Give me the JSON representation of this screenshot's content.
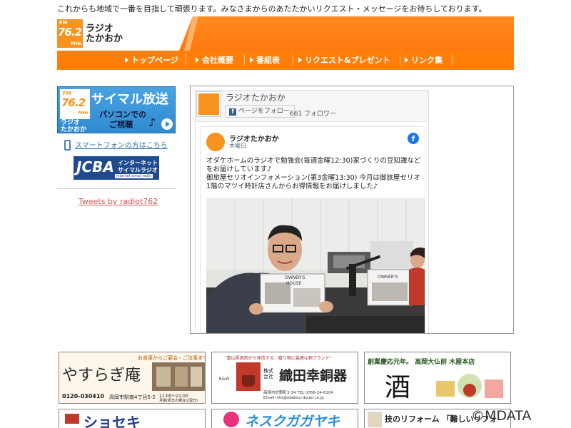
{
  "tagline": "これからも地域で一番を目指して頑張ります。みなさまからのあたたかいリクエスト・メッセージをお待ちしております。",
  "logo": {
    "fm": "FM",
    "freq": "76.2",
    "mhz": "MHz",
    "name_line1": "ラジオ",
    "name_line2": "たかおか"
  },
  "nav": [
    {
      "label": "トップページ"
    },
    {
      "label": "会社概要"
    },
    {
      "label": "番組表"
    },
    {
      "label": "リクエスト&プレゼント"
    },
    {
      "label": "リンク集"
    }
  ],
  "sidebar": {
    "simul": {
      "title": "サイマル放送",
      "sub1": "パソコンでの",
      "sub2": "ご視聴",
      "station1": "ラジオ",
      "station2": "たかおか"
    },
    "phone_link": "スマートフォンの方はこちら",
    "jcba": {
      "mark": "JCBA",
      "line1": "インターネット",
      "line2": "サイマルラジオ",
      "line3": "internet simul radio"
    },
    "tweets": "Tweets by radiot762"
  },
  "facebook": {
    "page_name": "ラジオたかおか",
    "follow_label": "ページをフォロー",
    "followers": "661 フォロワー",
    "post": {
      "author": "ラジオたかおか",
      "date": "木曜日",
      "text": "オダケホームのラジオで勉強会(毎週金曜12:30)家づくりの豆知識などをお届けしています♪\n御旅屋セリオインフォメーション(第3金曜13:30) 今月は御旅屋セリオ1階のマツイ時計店さんからお得情報をお届けしました♪",
      "sign1": "OWNER'S",
      "sign2": "HOUSE",
      "sign3": "OWNER'S"
    }
  },
  "ads": {
    "yasuragi": {
      "top": "お食事からご宴会・ご法事まで",
      "name": "やすらぎ庵",
      "tel": "0120-030410",
      "addr": "高岡市駅南4丁目5-2",
      "hours": "11:00～21:00",
      "closed": "月曜(祝日の場合は翌日)"
    },
    "oda": {
      "top": "\"富山県高岡から発信する、贈り物に最適な銅ブランド\"",
      "company_prefix": "株式会社",
      "company": "織田幸銅器",
      "brand": "R&W",
      "addr": "高岡市佐野町3-34 TEL 0766-24-6104",
      "email": "Email info@odakou-douki.co.jp"
    },
    "kiya": {
      "top": "創業慶応元年。 高岡大仏前 木屋本店",
      "char": "酒"
    },
    "row2a": "ショセキ",
    "row2b": "ネスクガガヤキ",
    "row2c": "技のリフォーム 「難しいリフォ"
  },
  "copyright": "©MDATA"
}
